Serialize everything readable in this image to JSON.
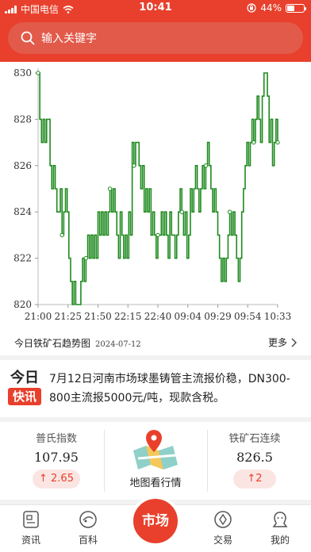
{
  "statusbar": {
    "carrier": "中国电信",
    "time": "10:41",
    "battery": "44%"
  },
  "search": {
    "placeholder": "输入关键字",
    "icon": "search-icon"
  },
  "chart_data": {
    "type": "line",
    "title": "今日铁矿石趋势图",
    "date": "2024-07-12",
    "ylim": [
      820,
      830
    ],
    "yticks": [
      820,
      822,
      824,
      826,
      828,
      830
    ],
    "xticks": [
      "21:00",
      "21:25",
      "21:50",
      "22:15",
      "22:40",
      "09:04",
      "09:29",
      "09:54",
      "10:33"
    ],
    "color": "#1e8a1e",
    "series": [
      {
        "values": [
          830,
          828,
          827,
          828,
          827,
          828,
          828,
          826,
          825,
          826,
          825,
          824,
          824,
          825,
          823,
          824,
          825,
          824,
          822,
          821,
          820,
          821,
          820,
          820,
          820,
          821,
          822,
          821,
          822,
          823,
          822,
          823,
          822,
          823,
          822,
          824,
          823,
          824,
          823,
          824,
          823,
          824,
          825,
          824,
          825,
          824,
          823,
          822,
          824,
          823,
          822,
          823,
          822,
          824,
          823,
          827,
          826,
          827,
          827,
          826,
          825,
          826,
          824,
          825,
          824,
          825,
          823,
          824,
          823,
          822,
          823,
          823,
          824,
          823,
          824,
          823,
          822,
          824,
          823,
          823,
          822,
          823,
          824,
          825,
          824,
          823,
          824,
          822,
          823,
          825,
          824,
          825,
          826,
          825,
          824,
          825,
          826,
          825,
          826,
          827,
          826,
          825,
          824,
          825,
          824,
          823,
          822,
          821,
          822,
          821,
          822,
          823,
          824,
          823,
          824,
          823,
          822,
          821,
          822,
          824,
          825,
          826,
          827,
          826,
          827,
          828,
          827,
          828,
          829,
          828,
          827,
          829,
          830,
          830,
          829,
          827,
          828,
          826,
          827,
          828,
          827
        ]
      }
    ]
  },
  "chart_footer": {
    "title": "今日铁矿石趋势图",
    "date": "2024-07-12",
    "more": "更多",
    "more_icon": "chevron-right-icon"
  },
  "news": {
    "badge_top": "今日",
    "badge_bottom": "快讯",
    "text": "7月12日河南市场球墨铸管主流报价稳，DN300-800主流报5000元/吨，现款含税。"
  },
  "tiles": {
    "left": {
      "label": "普氏指数",
      "value": "107.95",
      "change": "↑ 2.65"
    },
    "center": {
      "label": "地图看行情",
      "icon": "map-pin-icon"
    },
    "right": {
      "label": "铁矿石连续",
      "value": "826.5",
      "change": "↑2"
    }
  },
  "tabs": [
    {
      "label": "资讯",
      "icon": "news-icon"
    },
    {
      "label": "百科",
      "icon": "encyclopedia-icon"
    },
    {
      "label": "市场",
      "icon": "market-icon"
    },
    {
      "label": "交易",
      "icon": "trade-icon"
    },
    {
      "label": "我的",
      "icon": "profile-icon"
    }
  ],
  "colors": {
    "brand": "#e8402c",
    "line": "#1e8a1e"
  }
}
